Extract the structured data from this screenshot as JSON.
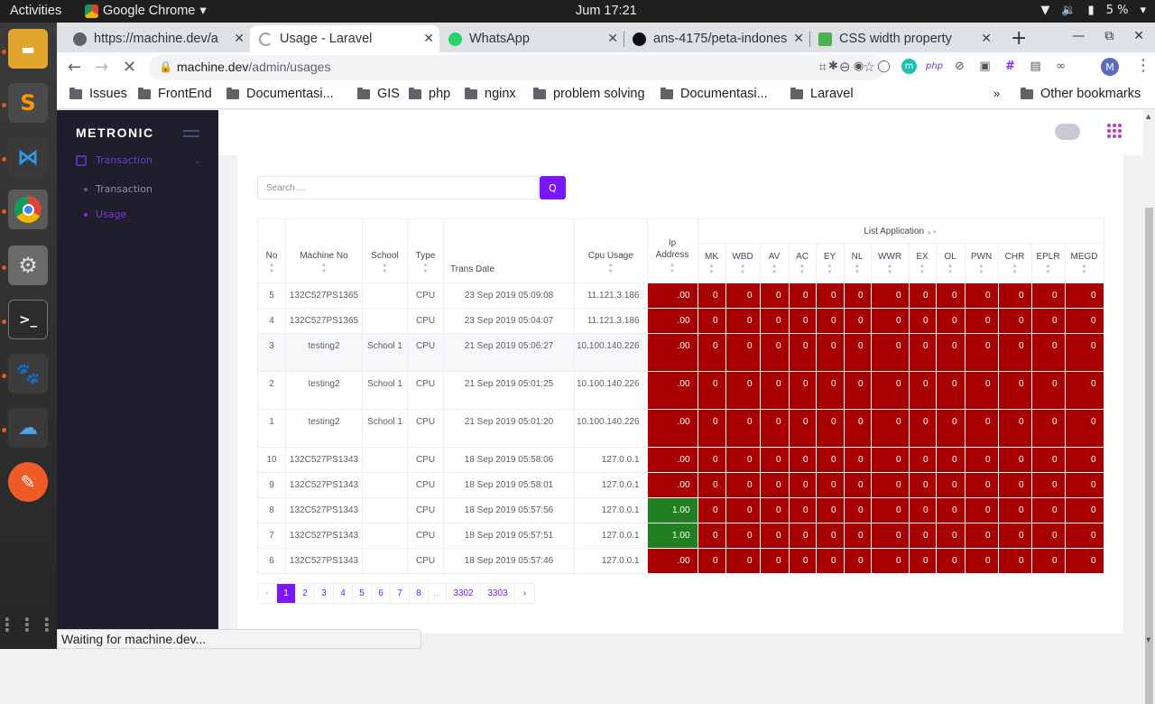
{
  "system": {
    "activities": "Activities",
    "app_name": "Google Chrome",
    "clock": "Jum 17:21",
    "battery": "5 %"
  },
  "tabs": [
    {
      "title": "https://machine.dev/a"
    },
    {
      "title": "Usage - Laravel"
    },
    {
      "title": "WhatsApp"
    },
    {
      "title": "ans-4175/peta-indones"
    },
    {
      "title": "CSS width property"
    }
  ],
  "omnibox": {
    "host": "machine.dev",
    "path": "/admin/usages",
    "profile_initial": "M"
  },
  "bookmarks": [
    "Issues",
    "FrontEnd",
    "Documentasi...",
    "GIS",
    "php",
    "nginx",
    "problem solving",
    "Documentasi...",
    "Laravel"
  ],
  "other_bookmarks": "Other bookmarks",
  "sidebar": {
    "brand": "METRONIC",
    "menu_main": "Transaction",
    "items": [
      "Transaction",
      "Usage"
    ]
  },
  "search": {
    "placeholder": "Search ...",
    "button": "Q"
  },
  "table": {
    "headers": {
      "no": "No",
      "machine": "Machine No",
      "school": "School",
      "type": "Type",
      "date": "Trans Date",
      "cpu": "Cpu Usage",
      "ip": "Ip Address",
      "list": "List Application"
    },
    "apps": [
      "MK",
      "WBD",
      "AV",
      "AC",
      "EY",
      "NL",
      "WWR",
      "EX",
      "OL",
      "PWN",
      "CHR",
      "EPLR",
      "MEGD"
    ],
    "rows": [
      {
        "no": "5",
        "machine": "132C527PS1365",
        "school": "",
        "type": "CPU",
        "date": "23 Sep 2019 05:09:08",
        "cpu": "11.121.3.186",
        "ip": ".00",
        "ip_green": false,
        "tall": false
      },
      {
        "no": "4",
        "machine": "132C527PS1365",
        "school": "",
        "type": "CPU",
        "date": "23 Sep 2019 05:04:07",
        "cpu": "11.121.3.186",
        "ip": ".00",
        "ip_green": false,
        "tall": false
      },
      {
        "no": "3",
        "machine": "testing2",
        "school": "School 1",
        "type": "CPU",
        "date": "21 Sep 2019 05:06:27",
        "cpu": "10.100.140.226",
        "ip": ".00",
        "ip_green": false,
        "tall": true
      },
      {
        "no": "2",
        "machine": "testing2",
        "school": "School 1",
        "type": "CPU",
        "date": "21 Sep 2019 05:01:25",
        "cpu": "10.100.140.226",
        "ip": ".00",
        "ip_green": false,
        "tall": true
      },
      {
        "no": "1",
        "machine": "testing2",
        "school": "School 1",
        "type": "CPU",
        "date": "21 Sep 2019 05:01:20",
        "cpu": "10.100.140.226",
        "ip": ".00",
        "ip_green": false,
        "tall": true
      },
      {
        "no": "10",
        "machine": "132C527PS1343",
        "school": "",
        "type": "CPU",
        "date": "18 Sep 2019 05:58:06",
        "cpu": "127.0.0.1",
        "ip": ".00",
        "ip_green": false,
        "tall": false
      },
      {
        "no": "9",
        "machine": "132C527PS1343",
        "school": "",
        "type": "CPU",
        "date": "18 Sep 2019 05:58:01",
        "cpu": "127.0.0.1",
        "ip": ".00",
        "ip_green": false,
        "tall": false
      },
      {
        "no": "8",
        "machine": "132C527PS1343",
        "school": "",
        "type": "CPU",
        "date": "18 Sep 2019 05:57:56",
        "cpu": "127.0.0.1",
        "ip": "1.00",
        "ip_green": true,
        "tall": false
      },
      {
        "no": "7",
        "machine": "132C527PS1343",
        "school": "",
        "type": "CPU",
        "date": "18 Sep 2019 05:57:51",
        "cpu": "127.0.0.1",
        "ip": "1.00",
        "ip_green": true,
        "tall": false
      },
      {
        "no": "6",
        "machine": "132C527PS1343",
        "school": "",
        "type": "CPU",
        "date": "18 Sep 2019 05:57:46",
        "cpu": "127.0.0.1",
        "ip": ".00",
        "ip_green": false,
        "tall": false
      }
    ],
    "app_value": "0"
  },
  "pagination": [
    "‹",
    "1",
    "2",
    "3",
    "4",
    "5",
    "6",
    "7",
    "8",
    "...",
    "3302",
    "3303",
    "›"
  ],
  "status": "Waiting for machine.dev..."
}
